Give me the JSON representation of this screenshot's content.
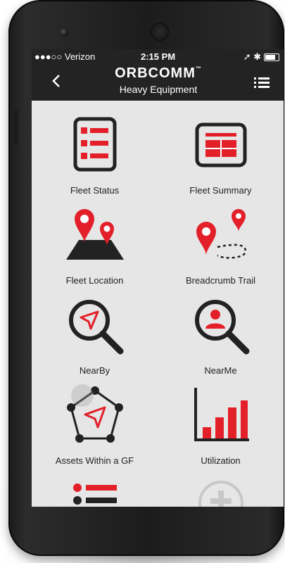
{
  "status_bar": {
    "carrier": "●●●○○ Verizon",
    "time": "2:15 PM",
    "right_icons": "➚ ✱"
  },
  "header": {
    "back_icon": "chevron-left",
    "logo": "ORBCOMM",
    "logo_tm": "™",
    "subtitle": "Heavy Equipment",
    "menu_icon": "list-menu"
  },
  "tiles": [
    {
      "label": "Fleet Status",
      "icon": "list-icon"
    },
    {
      "label": "Fleet Summary",
      "icon": "summary-icon"
    },
    {
      "label": "Fleet Location",
      "icon": "location-pins-icon"
    },
    {
      "label": "Breadcrumb Trail",
      "icon": "breadcrumb-trail-icon"
    },
    {
      "label": "NearBy",
      "icon": "nearby-search-icon"
    },
    {
      "label": "NearMe",
      "icon": "nearme-search-icon"
    },
    {
      "label": "Assets Within a GF",
      "icon": "geofence-icon"
    },
    {
      "label": "Utilization",
      "icon": "bar-chart-icon"
    },
    {
      "label": "",
      "icon": "list-partial-icon"
    },
    {
      "label": "",
      "icon": "add-icon"
    }
  ],
  "colors": {
    "accent": "#e3202a",
    "dark": "#232323",
    "screen_bg": "#e6e6e6"
  }
}
